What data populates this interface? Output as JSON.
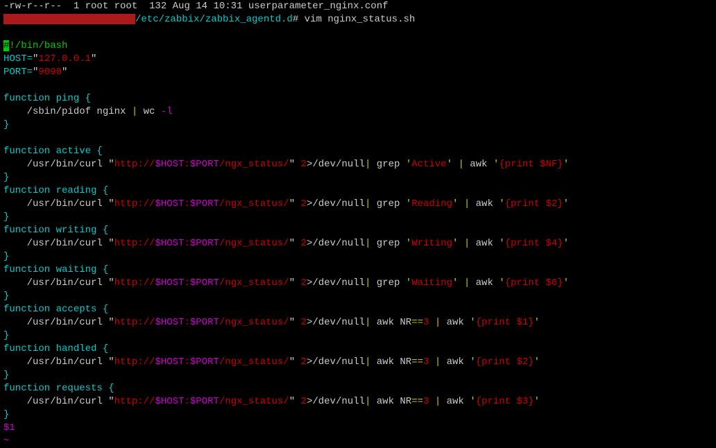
{
  "header": {
    "ls_line": "-rw-r--r--  1 root root  132 Aug 14 10:31 userparameter_nginx.conf",
    "prompt_path": "/etc/zabbix/zabbix_agentd.d",
    "prompt_hash": "#",
    "command": "vim nginx_status.sh"
  },
  "script": {
    "shebang_hash": "#",
    "shebang_rest": "!/bin/bash",
    "host_label": "HOST=",
    "host_q1": "\"",
    "host_val": "127.0.0.1",
    "host_q2": "\"",
    "port_label": "PORT=",
    "port_q1": "\"",
    "port_val": "9090",
    "port_q2": "\"",
    "fn_ping_decl": "function ping {",
    "ping_body1": "    /sbin/pidof nginx ",
    "ping_pipe": "|",
    "ping_body2": " wc ",
    "ping_flag": "-l",
    "close_brace": "}",
    "fn_active_decl": "function active {",
    "curl_cmd": "    /usr/bin/curl ",
    "url_q1": "\"",
    "url_pre": "http://",
    "url_host": "$HOST",
    "url_colon": ":",
    "url_port": "$PORT",
    "url_path": "/ngx_status/",
    "url_q2": "\"",
    "space": " ",
    "redir_2": "2",
    "redir_gt": ">",
    "devnull": "/dev/null",
    "pipe": "|",
    "grep": " grep ",
    "sq": "'",
    "grep_active": "Active",
    "grep_reading": "Reading",
    "grep_writing": "Writing",
    "grep_waiting": "Waiting",
    "awk": " awk ",
    "awk_nf": "{print $NF}",
    "awk_2": "{print $2}",
    "awk_4": "{print $4}",
    "awk_6": "{print $6}",
    "awk_1": "{print $1}",
    "awk_3": "{print $3}",
    "nr_pre": " awk NR",
    "nr_eq": "==",
    "nr_3": "3",
    "fn_reading_decl": "function reading {",
    "fn_writing_decl": "function writing {",
    "fn_waiting_decl": "function waiting {",
    "fn_accepts_decl": "function accepts {",
    "fn_handled_decl": "function handled {",
    "fn_requests_decl": "function requests {",
    "dollar1": "$1",
    "tilde": "~"
  }
}
